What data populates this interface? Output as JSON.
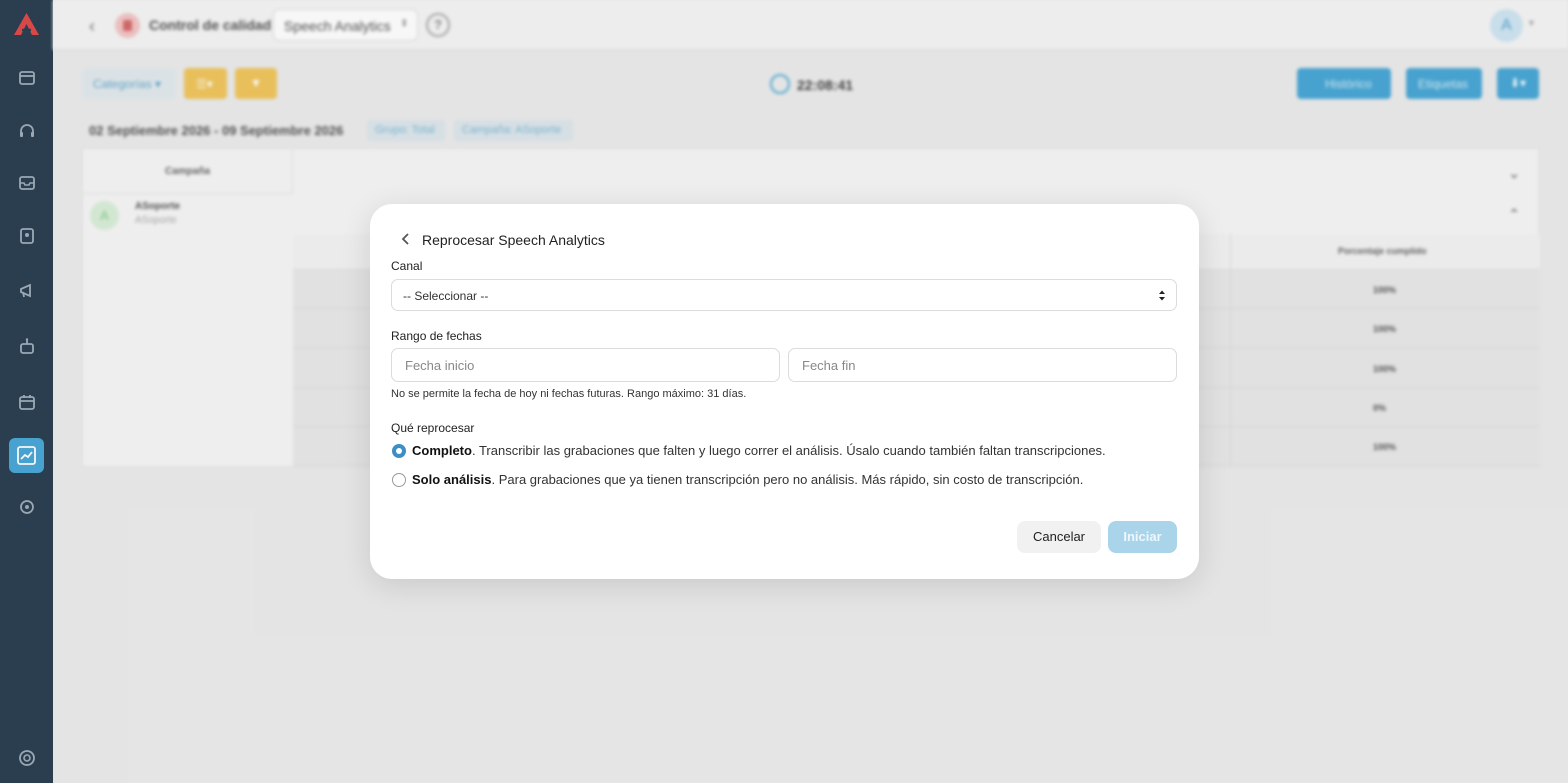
{
  "colors": {
    "sidebar_bg": "#2c4153",
    "brand_red": "#e14b4b",
    "accent_blue": "#4aa8d6",
    "accent_yellow": "#f0c65e",
    "radio_checked": "#3b8fc4",
    "disabled_button": "#a9d4ea"
  },
  "sidebar": {
    "logo_icon": "brand-logo-icon",
    "items": [
      {
        "icon": "dashboard-icon"
      },
      {
        "icon": "headset-icon"
      },
      {
        "icon": "inbox-icon"
      },
      {
        "icon": "contacts-icon"
      },
      {
        "icon": "megaphone-icon"
      },
      {
        "icon": "robot-icon"
      },
      {
        "icon": "calendar-icon"
      },
      {
        "icon": "quality-chart-icon",
        "active": true
      },
      {
        "icon": "settings-icon"
      },
      {
        "icon": "support-icon"
      }
    ]
  },
  "header": {
    "title": "Control de calidad",
    "module_select": "Speech Analytics",
    "help": "?",
    "avatar_initial": "A"
  },
  "toolbar": {
    "categories_label": "Categorías",
    "time": "22:08:41",
    "history_label": "Histórico",
    "tags_label": "Etiquetas"
  },
  "filters": {
    "date_range": "02 Septiembre 2026 - 09 Septiembre 2026",
    "chips": [
      "Grupo: Total",
      "Campaña: ASoporte"
    ]
  },
  "table": {
    "campaign_header": "Campaña",
    "campaign": {
      "initial": "A",
      "name": "ASoporte",
      "sub": "ASoporte"
    },
    "sub_header": "Porcentaje cumplido",
    "rows": [
      "100%",
      "100%",
      "100%",
      "0%",
      "100%"
    ]
  },
  "modal": {
    "title": "Reprocesar Speech Analytics",
    "channel_label": "Canal",
    "channel_value": "-- Seleccionar --",
    "date_label": "Rango de fechas",
    "start_placeholder": "Fecha inicio",
    "end_placeholder": "Fecha fin",
    "date_help": "No se permite la fecha de hoy ni fechas futuras. Rango máximo: 31 días.",
    "process_label": "Qué reprocesar",
    "options": [
      {
        "title": "Completo",
        "desc": ". Transcribir las grabaciones que falten y luego correr el análisis. Úsalo cuando también faltan transcripciones.",
        "checked": true
      },
      {
        "title": "Solo análisis",
        "desc": ". Para grabaciones que ya tienen transcripción pero no análisis. Más rápido, sin costo de transcripción.",
        "checked": false
      }
    ],
    "cancel_label": "Cancelar",
    "start_label": "Iniciar"
  }
}
